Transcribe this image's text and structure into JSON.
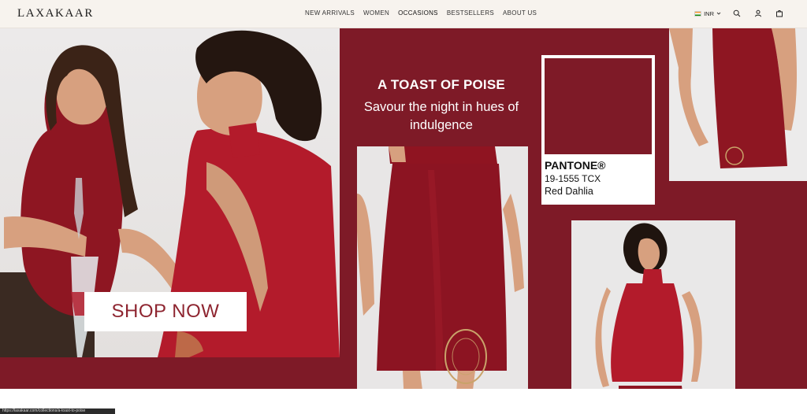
{
  "header": {
    "logo": "LAXAKAAR",
    "nav": [
      {
        "label": "NEW ARRIVALS"
      },
      {
        "label": "WOMEN"
      },
      {
        "label": "OCCASIONS"
      },
      {
        "label": "BESTSELLERS"
      },
      {
        "label": "ABOUT US"
      }
    ],
    "currency": "INR",
    "icons": [
      "chevron-down-icon",
      "search-icon",
      "user-icon",
      "bag-icon"
    ]
  },
  "banner": {
    "headline_title": "A TOAST OF POISE",
    "headline_sub": "Savour the night in hues of indulgence",
    "pantone_brand": "PANTONE®",
    "pantone_code": "19-1555 TCX",
    "pantone_color": "Red Dahlia",
    "shop_now": "SHOP NOW"
  },
  "colors": {
    "accent": "#7e1a27",
    "header_bg": "#f7f3ee",
    "dress": "#a61a2a"
  },
  "status_bar": "https://laxakaar.com/collections/a-toast-to-poise"
}
